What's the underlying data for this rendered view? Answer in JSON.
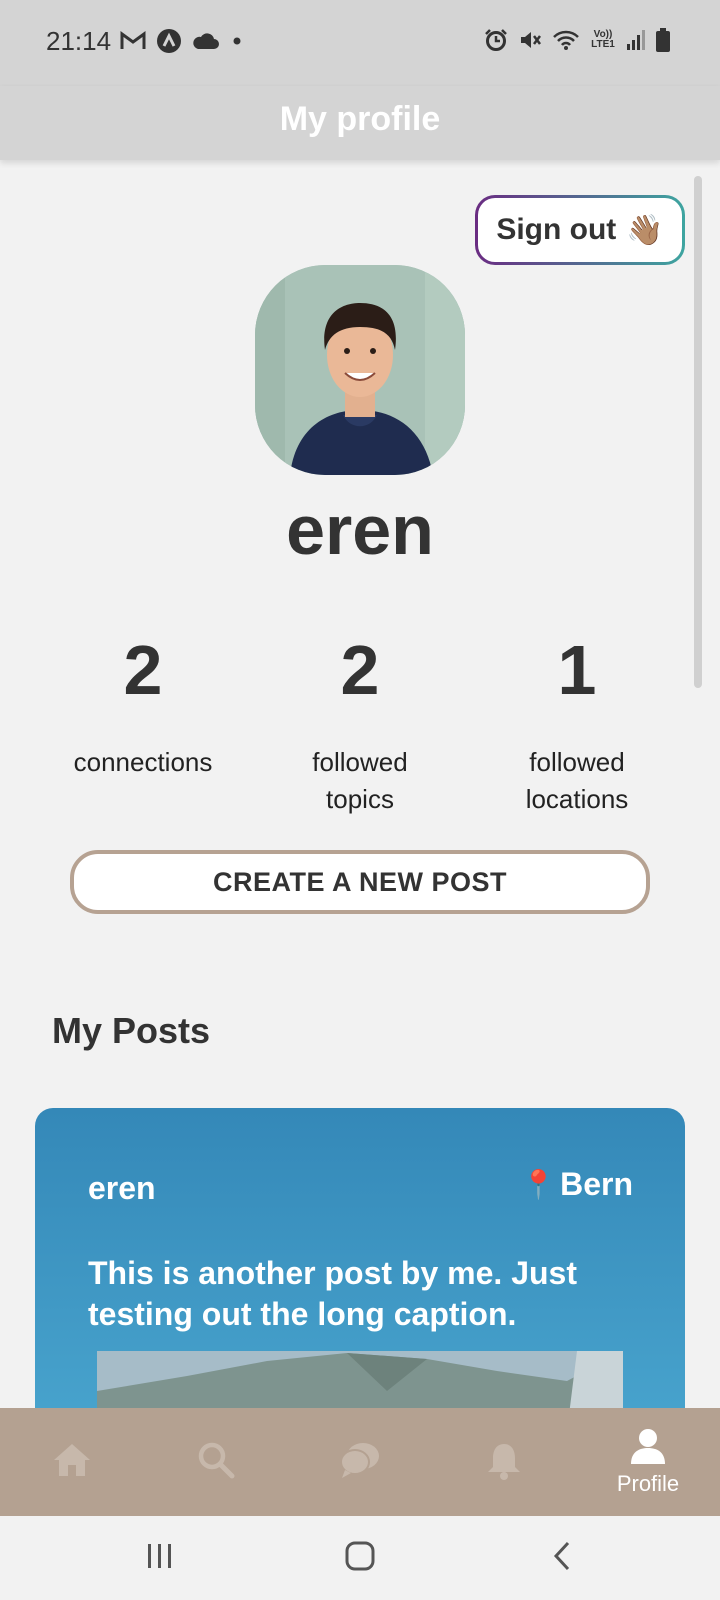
{
  "status_bar": {
    "time": "21:14",
    "left_icons": [
      "gmail-icon",
      "app-icon",
      "cloud-icon",
      "dot-icon"
    ],
    "right_icons": [
      "alarm-icon",
      "mute-icon",
      "wifi-icon",
      "volte-icon",
      "signal-icon",
      "battery-icon"
    ],
    "volte_text": "Vo))\nLTE1"
  },
  "header": {
    "title": "My profile"
  },
  "sign_out": {
    "label": "Sign out",
    "emoji": "👋🏽"
  },
  "profile": {
    "username": "eren"
  },
  "stats": [
    {
      "value": "2",
      "label": "connections"
    },
    {
      "value": "2",
      "label": "followed topics"
    },
    {
      "value": "1",
      "label": "followed locations"
    }
  ],
  "create_post": {
    "label": "CREATE A NEW POST"
  },
  "posts_section": {
    "title": "My Posts"
  },
  "posts": [
    {
      "author": "eren",
      "location_pin": "📍",
      "location": "Bern",
      "caption": "This is another post by me. Just testing out the long caption."
    }
  ],
  "bottom_nav": {
    "items": [
      {
        "icon": "home-icon",
        "label": ""
      },
      {
        "icon": "search-icon",
        "label": ""
      },
      {
        "icon": "chat-icon",
        "label": ""
      },
      {
        "icon": "bell-icon",
        "label": ""
      },
      {
        "icon": "person-icon",
        "label": "Profile",
        "active": true
      }
    ]
  },
  "colors": {
    "bar": "#d4d4d4",
    "background": "#f2f2f2",
    "nav": "#b4a191",
    "card_top": "#3488b8",
    "card_bottom": "#47a2cc",
    "button_border": "#b6a292"
  }
}
